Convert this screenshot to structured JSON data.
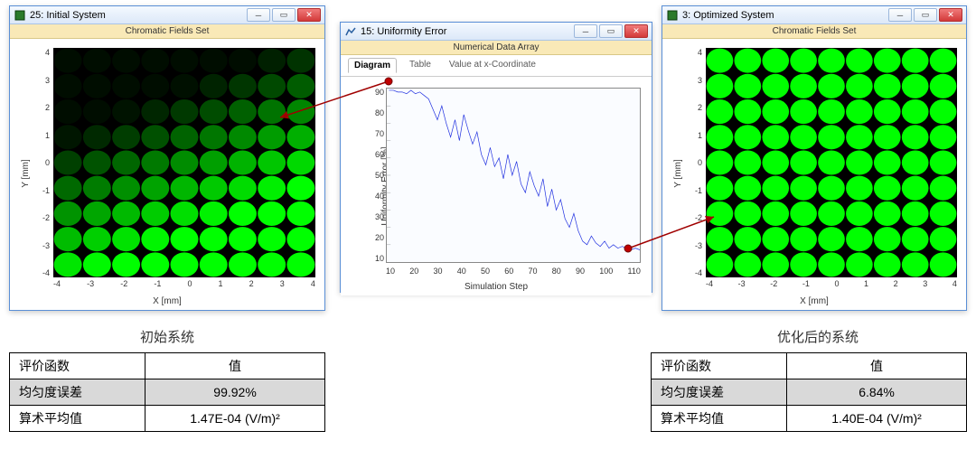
{
  "left_window": {
    "title": "25: Initial System",
    "subbar": "Chromatic Fields Set",
    "min_tip": "Minimize",
    "max_tip": "Maximize",
    "close_tip": "Close",
    "ylabel": "Y [mm]",
    "xlabel": "X [mm]",
    "yticks": [
      "-4",
      "-3",
      "-2",
      "-1",
      "0",
      "1",
      "2",
      "3",
      "4"
    ],
    "xticks": [
      "-4",
      "-3",
      "-2",
      "-1",
      "0",
      "1",
      "2",
      "3",
      "4"
    ],
    "grid": {
      "cols": 9,
      "rows": 9
    }
  },
  "mid_window": {
    "title": "15: Uniformity Error",
    "subbar": "Numerical Data Array",
    "min_tip": "Minimize",
    "max_tip": "Maximize",
    "close_tip": "Close",
    "tabs": [
      "Diagram",
      "Table",
      "Value at x-Coordinate"
    ],
    "active_tab": 0,
    "ylabel": "Uniformity Error [%]",
    "xlabel": "Simulation Step",
    "yticks": [
      "10",
      "20",
      "30",
      "40",
      "50",
      "60",
      "70",
      "80",
      "90"
    ],
    "xticks": [
      "10",
      "20",
      "30",
      "40",
      "50",
      "60",
      "70",
      "80",
      "90",
      "100",
      "110"
    ]
  },
  "right_window": {
    "title": "3: Optimized System",
    "subbar": "Chromatic Fields Set",
    "min_tip": "Minimize",
    "max_tip": "Maximize",
    "close_tip": "Close",
    "ylabel": "Y [mm]",
    "xlabel": "X [mm]",
    "yticks": [
      "-4",
      "-3",
      "-2",
      "-1",
      "0",
      "1",
      "2",
      "3",
      "4"
    ],
    "xticks": [
      "-4",
      "-3",
      "-2",
      "-1",
      "0",
      "1",
      "2",
      "3",
      "4"
    ],
    "grid": {
      "cols": 9,
      "rows": 9
    }
  },
  "captions": {
    "left": "初始系统",
    "right": "优化后的系统"
  },
  "tables": {
    "left": {
      "header": [
        "评价函数",
        "值"
      ],
      "rows": [
        [
          "均匀度误差",
          "99.92%"
        ],
        [
          "算术平均值",
          "1.47E-04 (V/m)²"
        ]
      ]
    },
    "right": {
      "header": [
        "评价函数",
        "值"
      ],
      "rows": [
        [
          "均匀度误差",
          "6.84%"
        ],
        [
          "算术平均值",
          "1.40E-04 (V/m)²"
        ]
      ]
    }
  },
  "chart_data": {
    "type": "line",
    "title": "",
    "xlabel": "Simulation Step",
    "ylabel": "Uniformity Error [%]",
    "xlim": [
      0,
      115
    ],
    "ylim": [
      0,
      100
    ],
    "x": [
      1,
      3,
      5,
      7,
      9,
      11,
      13,
      15,
      17,
      19,
      21,
      23,
      25,
      27,
      29,
      31,
      33,
      35,
      37,
      39,
      41,
      43,
      45,
      47,
      49,
      51,
      53,
      55,
      57,
      59,
      61,
      63,
      65,
      67,
      69,
      71,
      73,
      75,
      77,
      79,
      81,
      83,
      85,
      87,
      89,
      91,
      93,
      95,
      97,
      99,
      101,
      103,
      105,
      107,
      109,
      111,
      113,
      115
    ],
    "y": [
      99,
      99,
      98,
      98,
      97,
      99,
      97,
      98,
      96,
      94,
      88,
      82,
      90,
      80,
      72,
      82,
      70,
      85,
      76,
      68,
      75,
      62,
      56,
      66,
      55,
      60,
      48,
      62,
      50,
      58,
      45,
      40,
      52,
      44,
      38,
      48,
      32,
      42,
      30,
      36,
      25,
      20,
      28,
      18,
      12,
      10,
      15,
      11,
      9,
      12,
      8,
      10,
      8,
      9,
      8,
      7,
      8,
      7
    ]
  }
}
